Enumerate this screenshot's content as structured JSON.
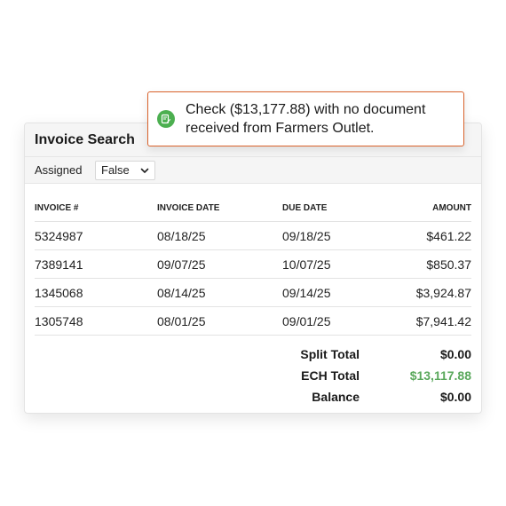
{
  "panel": {
    "title": "Invoice Search",
    "filter_label": "Assigned",
    "filter_value": "False"
  },
  "table": {
    "headers": [
      "INVOICE #",
      "INVOICE DATE",
      "DUE DATE",
      "AMOUNT"
    ],
    "rows": [
      [
        "5324987",
        "08/18/25",
        "09/18/25",
        "$461.22"
      ],
      [
        "7389141",
        "09/07/25",
        "10/07/25",
        "$850.37"
      ],
      [
        "1345068",
        "08/14/25",
        "09/14/25",
        "$3,924.87"
      ],
      [
        "1305748",
        "08/01/25",
        "09/01/25",
        "$7,941.42"
      ]
    ]
  },
  "totals": {
    "split_label": "Split Total",
    "split_value": "$0.00",
    "ech_label": "ECH Total",
    "ech_value": "$13,117.88",
    "balance_label": "Balance",
    "balance_value": "$0.00"
  },
  "toast": {
    "message": "Check ($13,177.88) with no document received from Farmers Outlet.",
    "icon": "document-edit-icon",
    "border_color": "#d9622b",
    "icon_color": "#4caf50"
  },
  "colors": {
    "ech_total": "#5aa85c"
  }
}
